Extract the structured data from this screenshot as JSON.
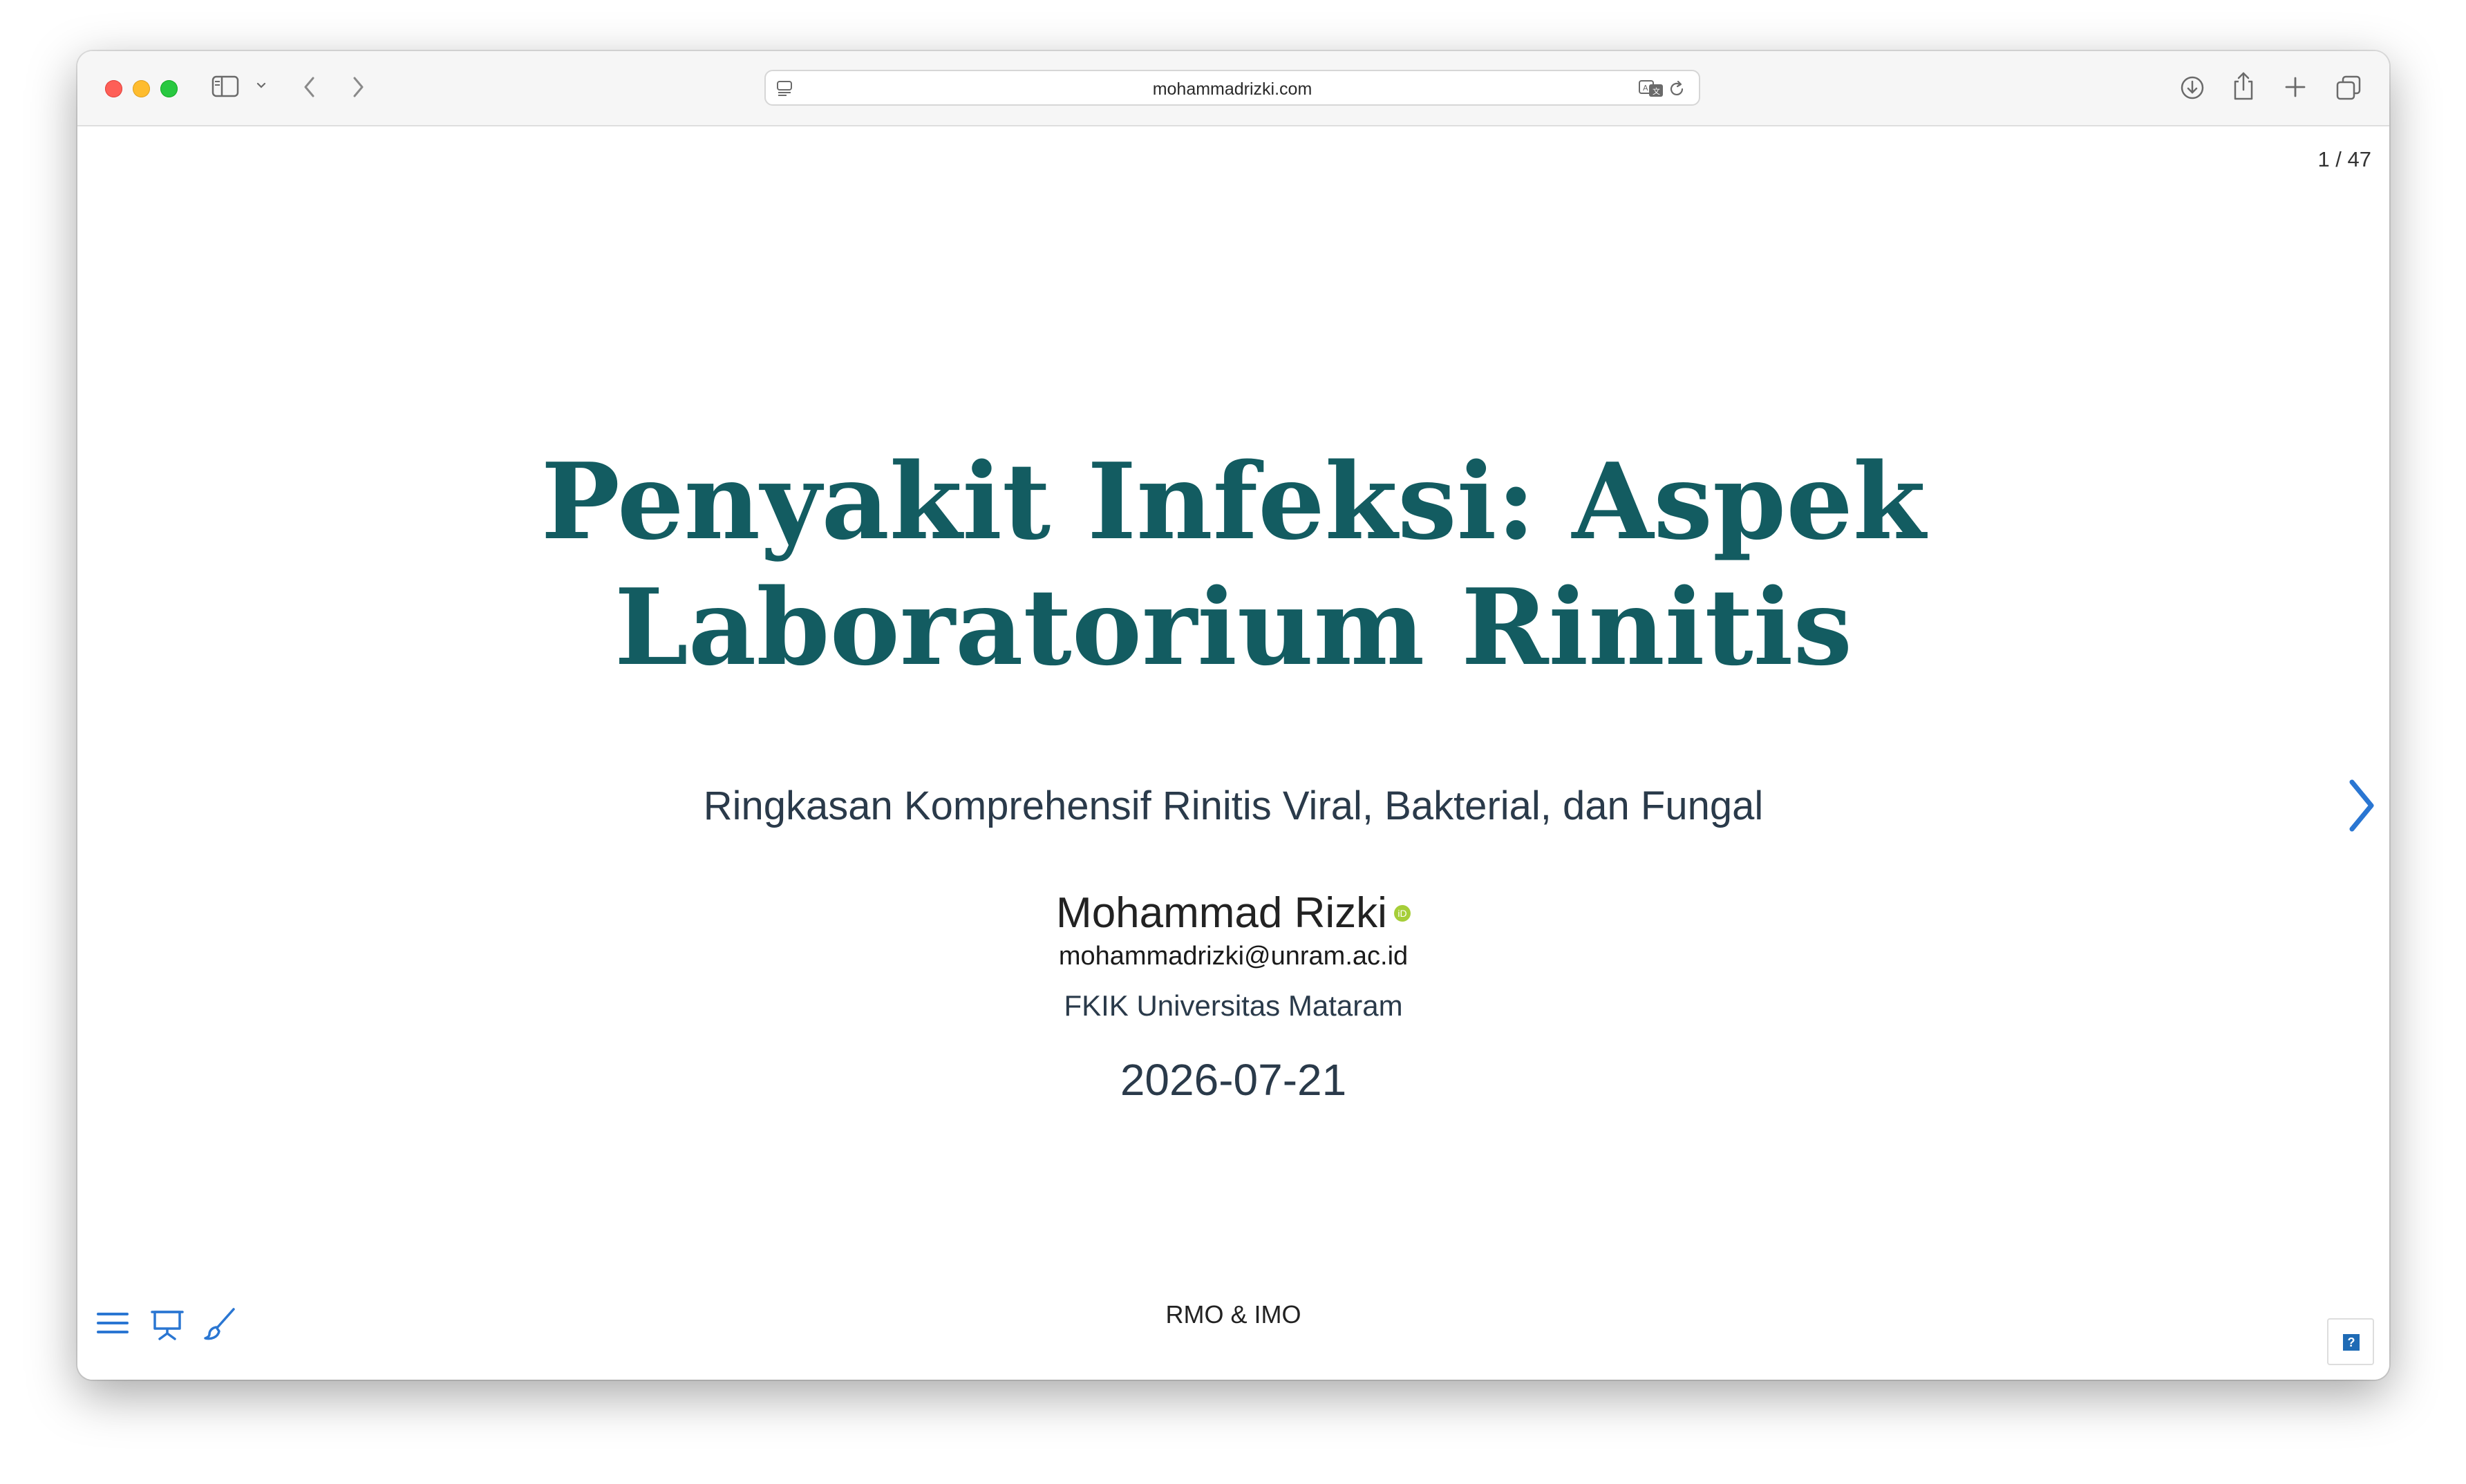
{
  "browser": {
    "url": "mohammadrizki.com"
  },
  "slide": {
    "counter": "1 / 47",
    "title_line1": "Penyakit Infeksi: Aspek",
    "title_line2": "Laboratorium Rinitis",
    "subtitle": "Ringkasan Komprehensif Rinitis Viral, Bakterial, dan Fungal",
    "author": "Mohammad Rizki",
    "orcid_icon": "iD",
    "email": "mohammadrizki@unram.ac.id",
    "affiliation": "FKIK Universitas Mataram",
    "date": "2026-07-21",
    "footer": "RMO & IMO",
    "help_label": "?"
  },
  "colors": {
    "title": "#135c61",
    "accent_blue": "#2a76d2",
    "orcid": "#a6ce39"
  },
  "icons": {
    "toolbar": [
      "sidebar-icon",
      "chevron-down-icon",
      "back-icon",
      "forward-icon",
      "download-icon",
      "share-icon",
      "new-tab-icon",
      "tabs-overview-icon"
    ],
    "url_bar": [
      "page-menu-icon",
      "translate-icon",
      "reload-icon"
    ],
    "slide_controls": [
      "menu-icon",
      "presentation-icon",
      "brush-icon",
      "next-slide-icon",
      "help-icon"
    ]
  }
}
